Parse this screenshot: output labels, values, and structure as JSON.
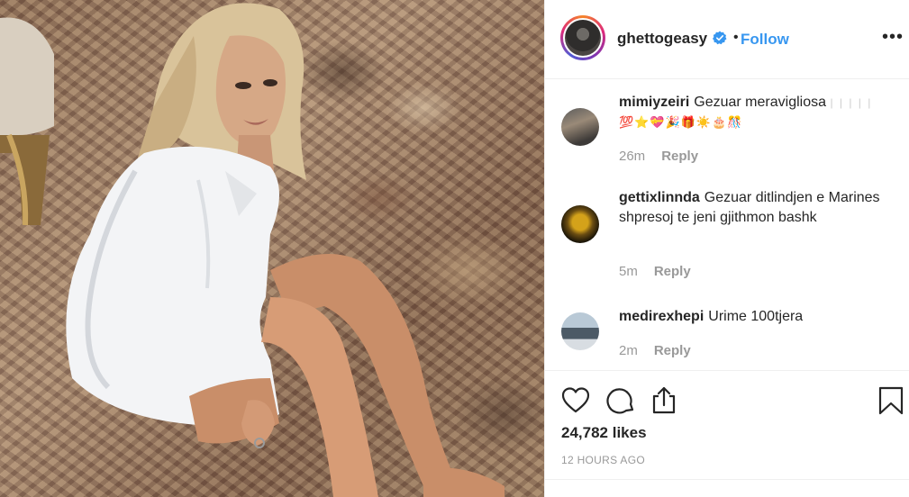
{
  "post": {
    "username": "ghettogeasy",
    "separator": "•",
    "follow_label": "Follow",
    "more_label": "•••",
    "likes": "24,782 likes",
    "time": "12 HOURS AGO"
  },
  "comments": [
    {
      "username": "mimiyzeiri",
      "text": "Gezuar meravigliosa",
      "bars": "| | | | |",
      "emoji": "💯⭐💝🎉🎁☀️🎂🎊",
      "age": "26m",
      "reply_label": "Reply"
    },
    {
      "username": "gettixlinnda",
      "text": "Gezuar ditlindjen e Marines shpresoj te jeni gjithmon bashk",
      "age": "5m",
      "reply_label": "Reply"
    },
    {
      "username": "medirexhepi",
      "text": "Urime 100tjera",
      "age": "2m",
      "reply_label": "Reply"
    }
  ],
  "icons": {
    "like": "heart-icon",
    "comment": "comment-icon",
    "share": "share-icon",
    "save": "bookmark-icon",
    "verified": "verified-badge-icon"
  },
  "colors": {
    "link": "#3897f0",
    "text": "#262626",
    "muted": "#999999",
    "border": "#efefef"
  }
}
